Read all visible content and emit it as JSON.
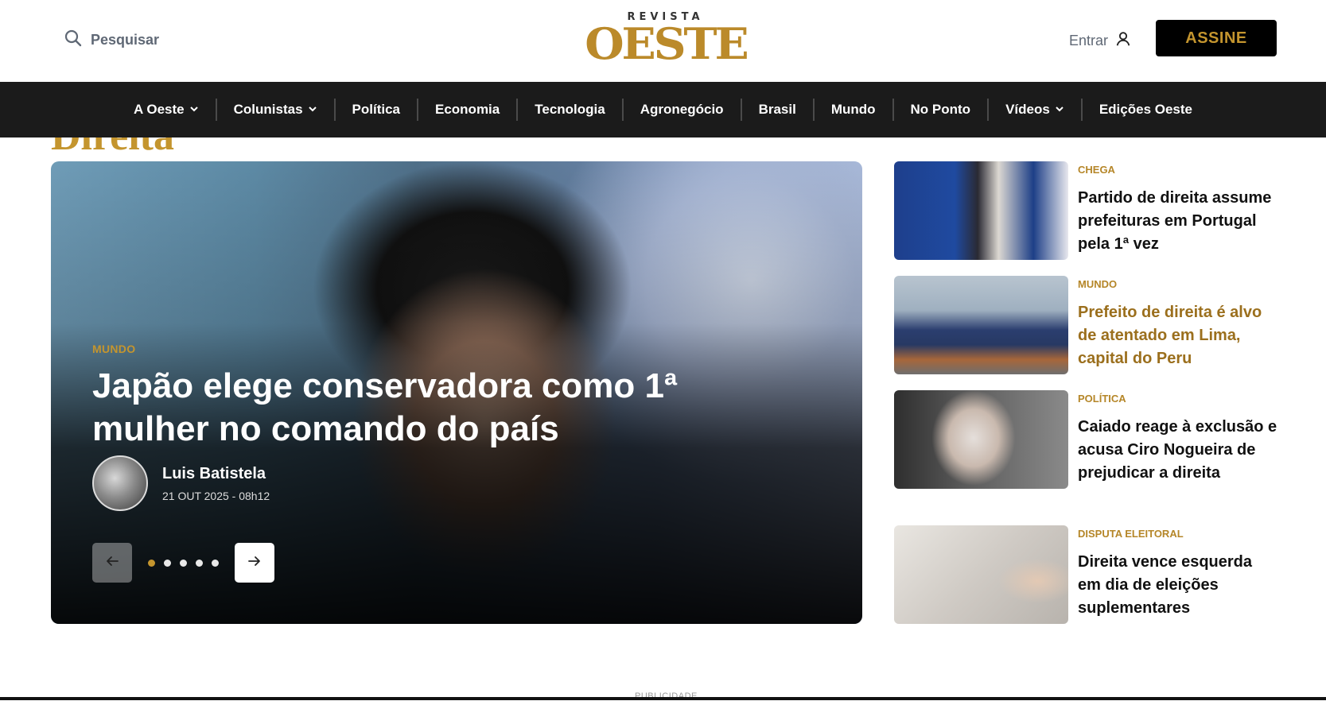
{
  "header": {
    "search_label": "Pesquisar",
    "logo_top": "REVISTA",
    "logo_main": "OESTE",
    "login_label": "Entrar",
    "subscribe_label": "ASSINE"
  },
  "nav": {
    "items": [
      {
        "label": "A Oeste",
        "dropdown": true
      },
      {
        "label": "Colunistas",
        "dropdown": true
      },
      {
        "label": "Política",
        "dropdown": false
      },
      {
        "label": "Economia",
        "dropdown": false
      },
      {
        "label": "Tecnologia",
        "dropdown": false
      },
      {
        "label": "Agronegócio",
        "dropdown": false
      },
      {
        "label": "Brasil",
        "dropdown": false
      },
      {
        "label": "Mundo",
        "dropdown": false
      },
      {
        "label": "No Ponto",
        "dropdown": false
      },
      {
        "label": "Vídeos",
        "dropdown": true
      },
      {
        "label": "Edições Oeste",
        "dropdown": false
      }
    ]
  },
  "section_title_peek": "Direita",
  "hero": {
    "tag": "MUNDO",
    "headline": "Japão elege conservadora como 1ª mulher no comando do país",
    "author": "Luis Batistela",
    "date": "21 OUT 2025 - 08h12",
    "slides_total": 5,
    "active_slide": 1
  },
  "sidebar": {
    "articles": [
      {
        "tag": "CHEGA",
        "title": "Partido de direita assume prefeituras em Portugal pela 1ª vez"
      },
      {
        "tag": "MUNDO",
        "title": "Prefeito de direita é alvo de atentado em Lima, capital do Peru"
      },
      {
        "tag": "POLÍTICA",
        "title": "Caiado reage à exclusão e acusa Ciro Nogueira de prejudicar a direita"
      },
      {
        "tag": "DISPUTA ELEITORAL",
        "title": "Direita vence esquerda em dia de eleições suplementares"
      }
    ]
  },
  "ad": {
    "label": "PUBLICIDADE"
  },
  "colors": {
    "brand_gold": "#c4952e",
    "nav_bg": "#1b1b1b",
    "link_gold": "#9b6f1d"
  }
}
